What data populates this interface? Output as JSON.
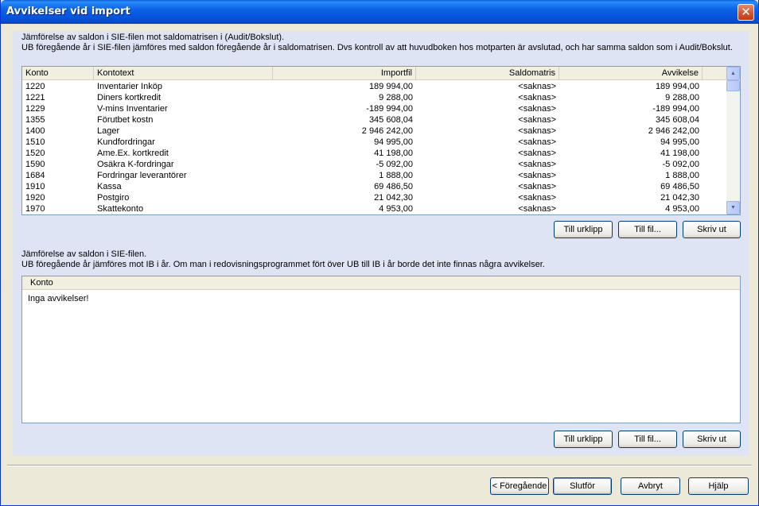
{
  "window": {
    "title": "Avvikelser vid import",
    "close_label": "✕"
  },
  "section1": {
    "desc_line1": "Jämförelse av saldon i SIE-filen mot saldomatrisen i (Audit/Bokslut).",
    "desc_line2": "UB föregående år i SIE-filen jämföres med saldon föregående år i saldomatrisen. Dvs kontroll av att huvudboken hos motparten är avslutad, och har samma saldon som i Audit/Bokslut.",
    "columns": [
      "Konto",
      "Kontotext",
      "Importfil",
      "Saldomatris",
      "Avvikelse"
    ],
    "rows": [
      [
        "1220",
        "Inventarier Inköp",
        "189 994,00",
        "<saknas>",
        "189 994,00"
      ],
      [
        "1221",
        "Diners kortkredit",
        "9 288,00",
        "<saknas>",
        "9 288,00"
      ],
      [
        "1229",
        "V-mins Inventarier",
        "-189 994,00",
        "<saknas>",
        "-189 994,00"
      ],
      [
        "1355",
        "Förutbet kostn",
        "345 608,04",
        "<saknas>",
        "345 608,04"
      ],
      [
        "1400",
        "Lager",
        "2 946 242,00",
        "<saknas>",
        "2 946 242,00"
      ],
      [
        "1510",
        "Kundfordringar",
        "94 995,00",
        "<saknas>",
        "94 995,00"
      ],
      [
        "1520",
        "Ame.Ex. kortkredit",
        "41 198,00",
        "<saknas>",
        "41 198,00"
      ],
      [
        "1590",
        "Osäkra K-fordringar",
        "-5 092,00",
        "<saknas>",
        "-5 092,00"
      ],
      [
        "1684",
        "Fordringar leverantörer",
        "1 888,00",
        "<saknas>",
        "1 888,00"
      ],
      [
        "1910",
        "Kassa",
        "69 486,50",
        "<saknas>",
        "69 486,50"
      ],
      [
        "1920",
        "Postgiro",
        "21 042,30",
        "<saknas>",
        "21 042,30"
      ],
      [
        "1970",
        "Skattekonto",
        "4 953,00",
        "<saknas>",
        "4 953,00"
      ]
    ],
    "buttons": {
      "clipboard": "Till urklipp",
      "file": "Till fil...",
      "print": "Skriv ut"
    }
  },
  "section2": {
    "desc_line1": "Jämförelse av saldon i SIE-filen.",
    "desc_line2": "UB föregående år jämföres mot IB i år. Om man i redovisningsprogrammet fört över UB till IB i år borde det inte finnas några avvikelser.",
    "columns": [
      "Konto"
    ],
    "empty_message": "Inga avvikelser!",
    "buttons": {
      "clipboard": "Till urklipp",
      "file": "Till fil...",
      "print": "Skriv ut"
    }
  },
  "footer": {
    "back": "< Föregående",
    "finish": "Slutför",
    "cancel": "Avbryt",
    "help": "Hjälp"
  },
  "scroll_icons": {
    "up": "▲",
    "down": "▼"
  }
}
